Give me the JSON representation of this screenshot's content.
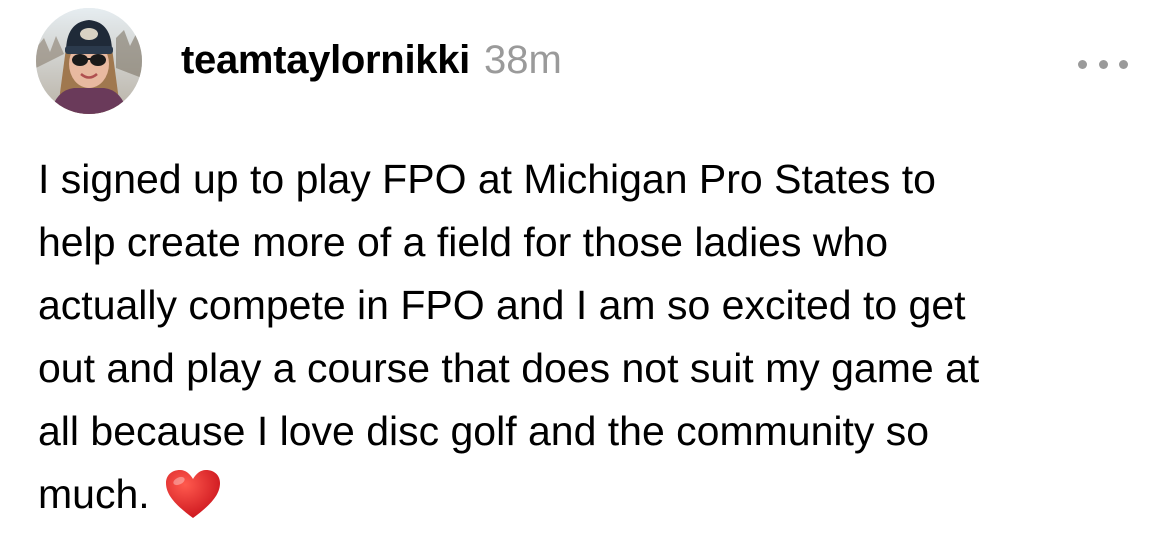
{
  "post": {
    "author": {
      "username": "teamtaylornikki",
      "avatar_icon": "profile-photo"
    },
    "timestamp": "38m",
    "more_icon": "more-horizontal-icon",
    "text_lines": [
      "I signed up to play FPO at Michigan Pro States to",
      "help create more of a field for those ladies who",
      "actually compete in FPO and I am so excited to get",
      "out and play a course that does not suit my game at",
      "all because I love disc golf and the community so",
      "much."
    ],
    "emoji_icon": "red-heart-icon",
    "colors": {
      "text": "#000000",
      "muted": "#9a9a9a",
      "heart": "#e0201f",
      "background": "#ffffff"
    }
  }
}
